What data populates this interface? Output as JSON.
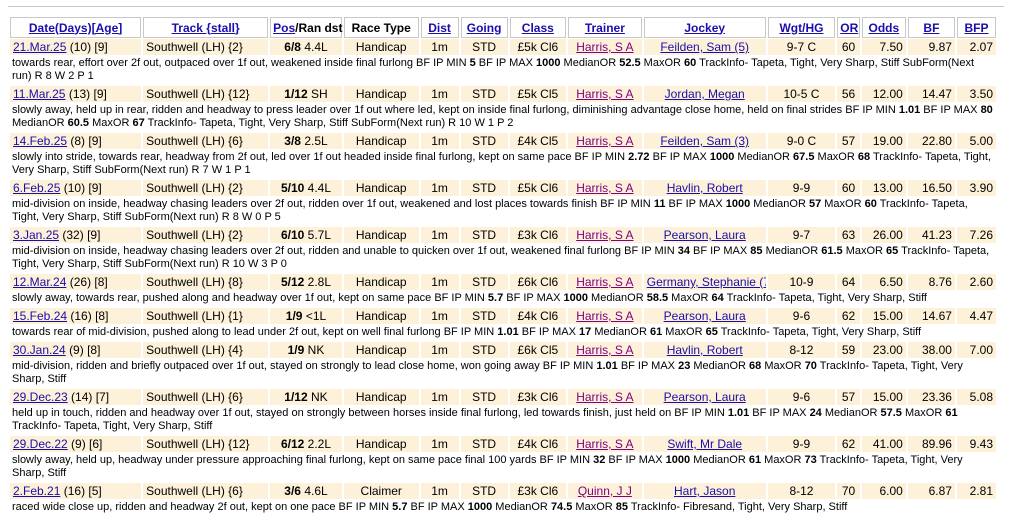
{
  "headers": {
    "date": "Date(Days)",
    "age": "[Age]",
    "track": "Track {stall}",
    "pos": "Pos",
    "ran_dst": "/Ran dst",
    "race_type": "Race Type",
    "dist": "Dist",
    "going": "Going",
    "class": "Class",
    "trainer": "Trainer",
    "jockey": "Jockey",
    "wgt": "Wgt/HG",
    "or": "OR",
    "odds": "Odds",
    "bf": "BF",
    "bfp": "BFP"
  },
  "runs": [
    {
      "date": "21.Mar.25",
      "days_age": "(10) [9]",
      "track": "Southwell (LH) {2}",
      "pos": "6/8",
      "dst": "4.4L",
      "race_type": "Handicap",
      "dist": "1m",
      "going": "STD",
      "class": "£5k Cl6",
      "trainer": "Harris, S A",
      "jockey": "Feilden, Sam (5)",
      "wgt": "9-7 C",
      "or": "60",
      "odds": "7.50",
      "bf": "9.87",
      "bfp": "2.07",
      "comment": [
        {
          "t": "towards rear, effort over 2f out, outpaced over 1f out, weakened inside final furlong BF IP MIN ",
          "b": false
        },
        {
          "t": "5",
          "b": true
        },
        {
          "t": " BF IP MAX ",
          "b": false
        },
        {
          "t": "1000",
          "b": true
        },
        {
          "t": " MedianOR ",
          "b": false
        },
        {
          "t": "52.5",
          "b": true
        },
        {
          "t": " MaxOR ",
          "b": false
        },
        {
          "t": "60",
          "b": true
        },
        {
          "t": " TrackInfo- Tapeta, Tight, Very Sharp, Stiff SubForm(Next run) R 8 W 2 P 1",
          "b": false
        }
      ]
    },
    {
      "date": "11.Mar.25",
      "days_age": "(13) [9]",
      "track": "Southwell (LH) {12}",
      "pos": "1/12",
      "dst": "SH",
      "race_type": "Handicap",
      "dist": "1m",
      "going": "STD",
      "class": "£5k Cl5",
      "trainer": "Harris, S A",
      "jockey": "Jordan, Megan",
      "wgt": "10-5 C",
      "or": "56",
      "odds": "12.00",
      "bf": "14.47",
      "bfp": "3.50",
      "comment": [
        {
          "t": "slowly away, held up in rear, ridden and headway to press leader over 1f out where led, kept on inside final furlong, diminishing advantage close home, held on final strides BF IP MIN ",
          "b": false
        },
        {
          "t": "1.01",
          "b": true
        },
        {
          "t": " BF IP MAX ",
          "b": false
        },
        {
          "t": "80",
          "b": true
        },
        {
          "t": " MedianOR ",
          "b": false
        },
        {
          "t": "60.5",
          "b": true
        },
        {
          "t": " MaxOR ",
          "b": false
        },
        {
          "t": "67",
          "b": true
        },
        {
          "t": " TrackInfo- Tapeta, Tight, Very Sharp, Stiff SubForm(Next run) R 10 W 1 P 2",
          "b": false
        }
      ]
    },
    {
      "date": "14.Feb.25",
      "days_age": "(8) [9]",
      "track": "Southwell (LH) {6}",
      "pos": "3/8",
      "dst": "2.5L",
      "race_type": "Handicap",
      "dist": "1m",
      "going": "STD",
      "class": "£4k Cl5",
      "trainer": "Harris, S A",
      "jockey": "Feilden, Sam (3)",
      "wgt": "9-0 C",
      "or": "57",
      "odds": "19.00",
      "bf": "22.80",
      "bfp": "5.00",
      "comment": [
        {
          "t": "slowly into stride, towards rear, headway from 2f out, led over 1f out headed inside final furlong, kept on same pace BF IP MIN ",
          "b": false
        },
        {
          "t": "2.72",
          "b": true
        },
        {
          "t": " BF IP MAX ",
          "b": false
        },
        {
          "t": "1000",
          "b": true
        },
        {
          "t": " MedianOR ",
          "b": false
        },
        {
          "t": "67.5",
          "b": true
        },
        {
          "t": " MaxOR ",
          "b": false
        },
        {
          "t": "68",
          "b": true
        },
        {
          "t": " TrackInfo- Tapeta, Tight, Very Sharp, Stiff SubForm(Next run) R 7 W 1 P 1",
          "b": false
        }
      ]
    },
    {
      "date": "6.Feb.25",
      "days_age": "(10) [9]",
      "track": "Southwell (LH) {2}",
      "pos": "5/10",
      "dst": "4.4L",
      "race_type": "Handicap",
      "dist": "1m",
      "going": "STD",
      "class": "£5k Cl6",
      "trainer": "Harris, S A",
      "jockey": "Havlin, Robert",
      "wgt": "9-9",
      "or": "60",
      "odds": "13.00",
      "bf": "16.50",
      "bfp": "3.90",
      "comment": [
        {
          "t": "mid-division on inside, headway chasing leaders over 2f out, ridden over 1f out, weakened and lost places towards finish BF IP MIN ",
          "b": false
        },
        {
          "t": "11",
          "b": true
        },
        {
          "t": " BF IP MAX ",
          "b": false
        },
        {
          "t": "1000",
          "b": true
        },
        {
          "t": " MedianOR ",
          "b": false
        },
        {
          "t": "57",
          "b": true
        },
        {
          "t": " MaxOR ",
          "b": false
        },
        {
          "t": "60",
          "b": true
        },
        {
          "t": " TrackInfo- Tapeta, Tight, Very Sharp, Stiff SubForm(Next run) R 8 W 0 P 5",
          "b": false
        }
      ]
    },
    {
      "date": "3.Jan.25",
      "days_age": "(32) [9]",
      "track": "Southwell (LH) {2}",
      "pos": "6/10",
      "dst": "5.7L",
      "race_type": "Handicap",
      "dist": "1m",
      "going": "STD",
      "class": "£3k Cl6",
      "trainer": "Harris, S A",
      "jockey": "Pearson, Laura",
      "wgt": "9-7",
      "or": "63",
      "odds": "26.00",
      "bf": "41.23",
      "bfp": "7.26",
      "comment": [
        {
          "t": "mid-division on inside, headway chasing leaders over 2f out, ridden and unable to quicken over 1f out, weakened final furlong BF IP MIN ",
          "b": false
        },
        {
          "t": "34",
          "b": true
        },
        {
          "t": " BF IP MAX ",
          "b": false
        },
        {
          "t": "85",
          "b": true
        },
        {
          "t": " MedianOR ",
          "b": false
        },
        {
          "t": "61.5",
          "b": true
        },
        {
          "t": " MaxOR ",
          "b": false
        },
        {
          "t": "65",
          "b": true
        },
        {
          "t": " TrackInfo- Tapeta, Tight, Very Sharp, Stiff SubForm(Next run) R 10 W 3 P 0",
          "b": false
        }
      ]
    },
    {
      "date": "12.Mar.24",
      "days_age": "(26) [8]",
      "track": "Southwell (LH) {8}",
      "pos": "5/12",
      "dst": "2.8L",
      "race_type": "Handicap",
      "dist": "1m",
      "going": "STD",
      "class": "£6k Cl6",
      "trainer": "Harris, S A",
      "jockey": "Germany, Stephanie (7)",
      "wgt": "10-9",
      "or": "64",
      "odds": "6.50",
      "bf": "8.76",
      "bfp": "2.60",
      "comment": [
        {
          "t": "slowly away, towards rear, pushed along and headway over 1f out, kept on same pace BF IP MIN ",
          "b": false
        },
        {
          "t": "5.7",
          "b": true
        },
        {
          "t": " BF IP MAX ",
          "b": false
        },
        {
          "t": "1000",
          "b": true
        },
        {
          "t": " MedianOR ",
          "b": false
        },
        {
          "t": "58.5",
          "b": true
        },
        {
          "t": " MaxOR ",
          "b": false
        },
        {
          "t": "64",
          "b": true
        },
        {
          "t": " TrackInfo- Tapeta, Tight, Very Sharp, Stiff",
          "b": false
        }
      ]
    },
    {
      "date": "15.Feb.24",
      "days_age": "(16) [8]",
      "track": "Southwell (LH) {1}",
      "pos": "1/9",
      "dst": "<1L",
      "race_type": "Handicap",
      "dist": "1m",
      "going": "STD",
      "class": "£4k Cl6",
      "trainer": "Harris, S A",
      "jockey": "Pearson, Laura",
      "wgt": "9-6",
      "or": "62",
      "odds": "15.00",
      "bf": "14.67",
      "bfp": "4.47",
      "comment": [
        {
          "t": "towards rear of mid-division, pushed along to lead under 2f out, kept on well final furlong BF IP MIN ",
          "b": false
        },
        {
          "t": "1.01",
          "b": true
        },
        {
          "t": " BF IP MAX ",
          "b": false
        },
        {
          "t": "17",
          "b": true
        },
        {
          "t": " MedianOR ",
          "b": false
        },
        {
          "t": "61",
          "b": true
        },
        {
          "t": " MaxOR ",
          "b": false
        },
        {
          "t": "65",
          "b": true
        },
        {
          "t": " TrackInfo- Tapeta, Tight, Very Sharp, Stiff",
          "b": false
        }
      ]
    },
    {
      "date": "30.Jan.24",
      "days_age": "(9) [8]",
      "track": "Southwell (LH) {4}",
      "pos": "1/9",
      "dst": "NK",
      "race_type": "Handicap",
      "dist": "1m",
      "going": "STD",
      "class": "£6k Cl5",
      "trainer": "Harris, S A",
      "jockey": "Havlin, Robert",
      "wgt": "8-12",
      "or": "59",
      "odds": "23.00",
      "bf": "38.00",
      "bfp": "7.00",
      "comment": [
        {
          "t": "mid-division, ridden and briefly outpaced over 1f out, stayed on strongly to lead close home, won going away BF IP MIN ",
          "b": false
        },
        {
          "t": "1.01",
          "b": true
        },
        {
          "t": " BF IP MAX ",
          "b": false
        },
        {
          "t": "23",
          "b": true
        },
        {
          "t": " MedianOR ",
          "b": false
        },
        {
          "t": "68",
          "b": true
        },
        {
          "t": " MaxOR ",
          "b": false
        },
        {
          "t": "70",
          "b": true
        },
        {
          "t": " TrackInfo- Tapeta, Tight, Very Sharp, Stiff",
          "b": false
        }
      ]
    },
    {
      "date": "29.Dec.23",
      "days_age": "(14) [7]",
      "track": "Southwell (LH) {6}",
      "pos": "1/12",
      "dst": "NK",
      "race_type": "Handicap",
      "dist": "1m",
      "going": "STD",
      "class": "£3k Cl6",
      "trainer": "Harris, S A",
      "jockey": "Pearson, Laura",
      "wgt": "9-6",
      "or": "57",
      "odds": "15.00",
      "bf": "23.36",
      "bfp": "5.08",
      "comment": [
        {
          "t": "held up in touch, ridden and headway over 1f out, stayed on strongly between horses inside final furlong, led towards finish, just held on BF IP MIN ",
          "b": false
        },
        {
          "t": "1.01",
          "b": true
        },
        {
          "t": " BF IP MAX ",
          "b": false
        },
        {
          "t": "24",
          "b": true
        },
        {
          "t": " MedianOR ",
          "b": false
        },
        {
          "t": "57.5",
          "b": true
        },
        {
          "t": " MaxOR ",
          "b": false
        },
        {
          "t": "61",
          "b": true
        },
        {
          "t": " TrackInfo- Tapeta, Tight, Very Sharp, Stiff",
          "b": false
        }
      ]
    },
    {
      "date": "29.Dec.22",
      "days_age": "(9) [6]",
      "track": "Southwell (LH) {12}",
      "pos": "6/12",
      "dst": "2.2L",
      "race_type": "Handicap",
      "dist": "1m",
      "going": "STD",
      "class": "£4k Cl6",
      "trainer": "Harris, S A",
      "jockey": "Swift, Mr Dale",
      "wgt": "9-9",
      "or": "62",
      "odds": "41.00",
      "bf": "89.96",
      "bfp": "9.43",
      "comment": [
        {
          "t": "slowly away, held up, headway under pressure approaching final furlong, kept on same pace final 100 yards BF IP MIN ",
          "b": false
        },
        {
          "t": "32",
          "b": true
        },
        {
          "t": " BF IP MAX ",
          "b": false
        },
        {
          "t": "1000",
          "b": true
        },
        {
          "t": " MedianOR ",
          "b": false
        },
        {
          "t": "61",
          "b": true
        },
        {
          "t": " MaxOR ",
          "b": false
        },
        {
          "t": "73",
          "b": true
        },
        {
          "t": " TrackInfo- Tapeta, Tight, Very Sharp, Stiff",
          "b": false
        }
      ]
    },
    {
      "date": "2.Feb.21",
      "days_age": "(16) [5]",
      "track": "Southwell (LH) {6}",
      "pos": "3/6",
      "dst": "4.6L",
      "race_type": "Claimer",
      "dist": "1m",
      "going": "STD",
      "class": "£3k Cl6",
      "trainer": "Quinn, J J",
      "jockey": "Hart, Jason",
      "wgt": "8-12",
      "or": "70",
      "odds": "6.00",
      "bf": "6.87",
      "bfp": "2.81",
      "comment": [
        {
          "t": "raced wide close up, ridden and headway 2f out, kept on one pace BF IP MIN ",
          "b": false
        },
        {
          "t": "5.7",
          "b": true
        },
        {
          "t": " BF IP MAX ",
          "b": false
        },
        {
          "t": "1000",
          "b": true
        },
        {
          "t": " MedianOR ",
          "b": false
        },
        {
          "t": "74.5",
          "b": true
        },
        {
          "t": " MaxOR ",
          "b": false
        },
        {
          "t": "85",
          "b": true
        },
        {
          "t": " TrackInfo- Fibresand, Tight, Very Sharp, Stiff",
          "b": false
        }
      ]
    }
  ]
}
